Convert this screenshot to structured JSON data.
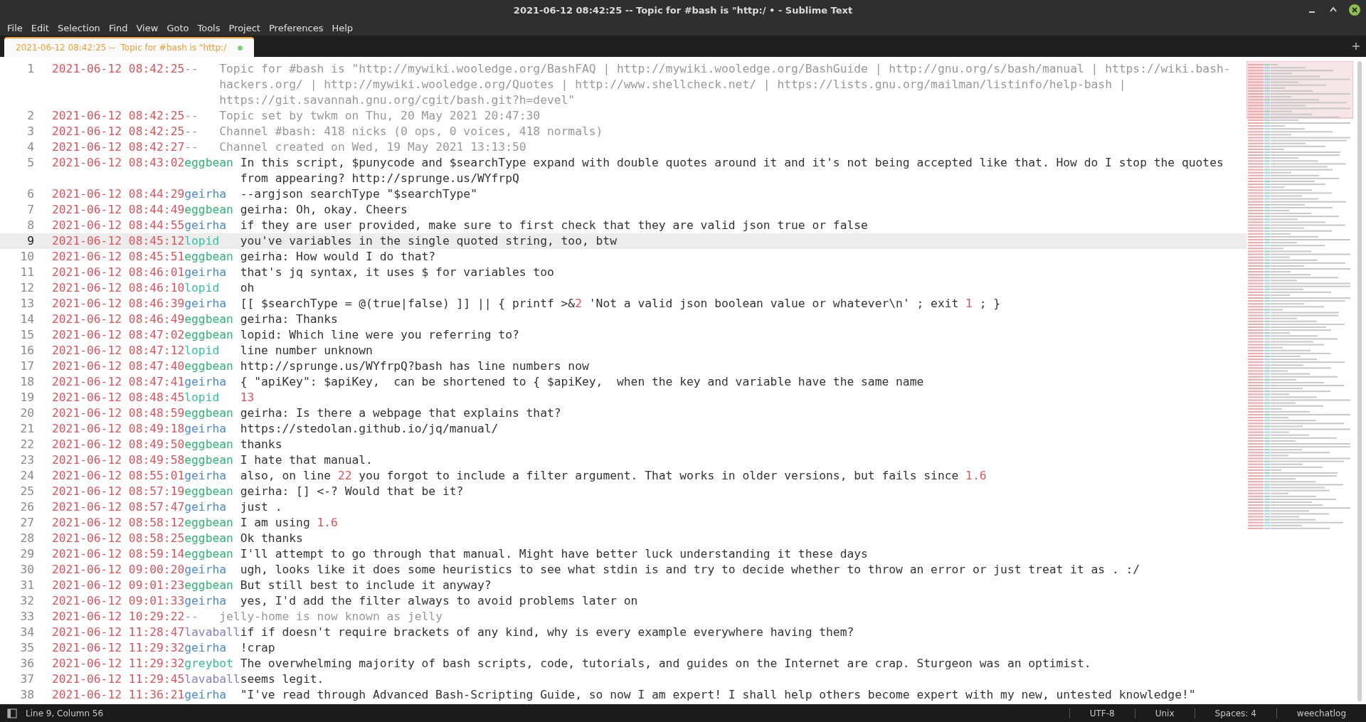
{
  "window": {
    "title": "2021-06-12 08:42:25 --  Topic for #bash is \"http:/ • - Sublime Text"
  },
  "menu": [
    "File",
    "Edit",
    "Selection",
    "Find",
    "View",
    "Goto",
    "Tools",
    "Project",
    "Preferences",
    "Help"
  ],
  "tabs": [
    {
      "label": "2021-06-12 08:42:25 --  Topic for #bash is \"http:/",
      "selected": true,
      "modified": true
    }
  ],
  "lines": [
    {
      "num": "1",
      "time": "2021-06-12 08:42:25",
      "kind": "system",
      "nick": "--",
      "color": "#a0a0a0",
      "current": false,
      "message": [
        {
          "kind": "text",
          "text": "Topic for #bash is \"http://mywiki.wooledge.org/BashFAQ | http://mywiki.wooledge.org/BashGuide | http://gnu.org/s/bash/manual | https://wiki.bash-hackers.org/ | http://mywiki.wooledge.org/Quotes | http://www.shellcheck.net/ | https://lists.gnu.org/mailman/listinfo/help-bash | https://git.savannah.gnu.org/cgit/bash.git?h=devel\""
        }
      ]
    },
    {
      "num": "2",
      "time": "2021-06-12 08:42:25",
      "kind": "system",
      "nick": "--",
      "color": "#a0a0a0",
      "current": false,
      "message": [
        {
          "kind": "text",
          "text": "Topic set by twkm on Thu, 20 May 2021 20:47:30"
        }
      ]
    },
    {
      "num": "3",
      "time": "2021-06-12 08:42:25",
      "kind": "system",
      "nick": "--",
      "color": "#a0a0a0",
      "current": false,
      "message": [
        {
          "kind": "text",
          "text": "Channel #bash: 418 nicks (0 ops, 0 voices, 418 normals)"
        }
      ]
    },
    {
      "num": "4",
      "time": "2021-06-12 08:42:27",
      "kind": "system",
      "nick": "--",
      "color": "#a0a0a0",
      "current": false,
      "message": [
        {
          "kind": "text",
          "text": "Channel created on Wed, 19 May 2021 13:13:50"
        }
      ]
    },
    {
      "num": "5",
      "time": "2021-06-12 08:43:02",
      "kind": "message",
      "nick": "eggbean",
      "color": "#2bb673",
      "current": false,
      "message": [
        {
          "kind": "text",
          "text": "In this script, $punycode and $searchType expand with double quotes around it and it's not being accepted like that. How do I stop the quotes from appearing? http://sprunge.us/WYfrpQ"
        }
      ]
    },
    {
      "num": "6",
      "time": "2021-06-12 08:44:29",
      "kind": "message",
      "nick": "geirha",
      "color": "#4a8bd0",
      "current": false,
      "message": [
        {
          "kind": "text",
          "text": "--argjson searchType \"$searchType\""
        }
      ]
    },
    {
      "num": "7",
      "time": "2021-06-12 08:44:49",
      "kind": "message",
      "nick": "eggbean",
      "color": "#2bb673",
      "current": false,
      "message": [
        {
          "kind": "text",
          "text": "geirha: Oh, okay. Cheers"
        }
      ]
    },
    {
      "num": "8",
      "time": "2021-06-12 08:44:55",
      "kind": "message",
      "nick": "geirha",
      "color": "#4a8bd0",
      "current": false,
      "message": [
        {
          "kind": "text",
          "text": "if they are user provided, make sure to first check that they are valid json true or false"
        }
      ]
    },
    {
      "num": "9",
      "time": "2021-06-12 08:45:12",
      "kind": "message",
      "nick": "lopid",
      "color": "#2ec4a3",
      "current": true,
      "message": [
        {
          "kind": "text",
          "text": "you've variables in the single quoted string, too, btw"
        }
      ]
    },
    {
      "num": "10",
      "time": "2021-06-12 08:45:51",
      "kind": "message",
      "nick": "eggbean",
      "color": "#2bb673",
      "current": false,
      "message": [
        {
          "kind": "text",
          "text": "geirha: How would I do that?"
        }
      ]
    },
    {
      "num": "11",
      "time": "2021-06-12 08:46:01",
      "kind": "message",
      "nick": "geirha",
      "color": "#4a8bd0",
      "current": false,
      "message": [
        {
          "kind": "text",
          "text": "that's jq syntax, it uses $ for variables too"
        }
      ]
    },
    {
      "num": "12",
      "time": "2021-06-12 08:46:10",
      "kind": "message",
      "nick": "lopid",
      "color": "#2ec4a3",
      "current": false,
      "message": [
        {
          "kind": "text",
          "text": "oh"
        }
      ]
    },
    {
      "num": "13",
      "time": "2021-06-12 08:46:39",
      "kind": "message",
      "nick": "geirha",
      "color": "#4a8bd0",
      "current": false,
      "message": [
        {
          "kind": "text",
          "text": "[[ $searchType = @(true|false) ]] || { printf >&"
        },
        {
          "kind": "number",
          "text": "2"
        },
        {
          "kind": "text",
          "text": " 'Not a valid json boolean value or whatever\\n' ; exit "
        },
        {
          "kind": "number",
          "text": "1"
        },
        {
          "kind": "text",
          "text": " ; }"
        }
      ]
    },
    {
      "num": "14",
      "time": "2021-06-12 08:46:49",
      "kind": "message",
      "nick": "eggbean",
      "color": "#2bb673",
      "current": false,
      "message": [
        {
          "kind": "text",
          "text": "geirha: Thanks"
        }
      ]
    },
    {
      "num": "15",
      "time": "2021-06-12 08:47:02",
      "kind": "message",
      "nick": "eggbean",
      "color": "#2bb673",
      "current": false,
      "message": [
        {
          "kind": "text",
          "text": "lopid: Which line were you referring to?"
        }
      ]
    },
    {
      "num": "16",
      "time": "2021-06-12 08:47:12",
      "kind": "message",
      "nick": "lopid",
      "color": "#2ec4a3",
      "current": false,
      "message": [
        {
          "kind": "text",
          "text": "line number unknown"
        }
      ]
    },
    {
      "num": "17",
      "time": "2021-06-12 08:47:40",
      "kind": "message",
      "nick": "eggbean",
      "color": "#2bb673",
      "current": false,
      "message": [
        {
          "kind": "text",
          "text": "http://sprunge.us/WYfrpQ?bash has line numbers now"
        }
      ]
    },
    {
      "num": "18",
      "time": "2021-06-12 08:47:41",
      "kind": "message",
      "nick": "geirha",
      "color": "#4a8bd0",
      "current": false,
      "message": [
        {
          "kind": "text",
          "text": "{ \"apiKey\": $apiKey,  can be shortened to { $apiKey,  when the key and variable have the same name"
        }
      ]
    },
    {
      "num": "19",
      "time": "2021-06-12 08:48:45",
      "kind": "message",
      "nick": "lopid",
      "color": "#2ec4a3",
      "current": false,
      "message": [
        {
          "kind": "number",
          "text": "13"
        }
      ]
    },
    {
      "num": "20",
      "time": "2021-06-12 08:48:59",
      "kind": "message",
      "nick": "eggbean",
      "color": "#2bb673",
      "current": false,
      "message": [
        {
          "kind": "text",
          "text": "geirha: Is there a webpage that explains that?"
        }
      ]
    },
    {
      "num": "21",
      "time": "2021-06-12 08:49:18",
      "kind": "message",
      "nick": "geirha",
      "color": "#4a8bd0",
      "current": false,
      "message": [
        {
          "kind": "text",
          "text": "https://stedolan.github.io/jq/manual/"
        }
      ]
    },
    {
      "num": "22",
      "time": "2021-06-12 08:49:50",
      "kind": "message",
      "nick": "eggbean",
      "color": "#2bb673",
      "current": false,
      "message": [
        {
          "kind": "text",
          "text": "thanks"
        }
      ]
    },
    {
      "num": "23",
      "time": "2021-06-12 08:49:58",
      "kind": "message",
      "nick": "eggbean",
      "color": "#2bb673",
      "current": false,
      "message": [
        {
          "kind": "text",
          "text": "I hate that manual."
        }
      ]
    },
    {
      "num": "24",
      "time": "2021-06-12 08:55:01",
      "kind": "message",
      "nick": "geirha",
      "color": "#4a8bd0",
      "current": false,
      "message": [
        {
          "kind": "text",
          "text": "also, on line "
        },
        {
          "kind": "number",
          "text": "22"
        },
        {
          "kind": "text",
          "text": " you forgot to include a filter argument. That works in older versions, but fails since "
        },
        {
          "kind": "number",
          "text": "1.6"
        }
      ]
    },
    {
      "num": "25",
      "time": "2021-06-12 08:57:19",
      "kind": "message",
      "nick": "eggbean",
      "color": "#2bb673",
      "current": false,
      "message": [
        {
          "kind": "text",
          "text": "geirha: [] <-? Would that be it?"
        }
      ]
    },
    {
      "num": "26",
      "time": "2021-06-12 08:57:47",
      "kind": "message",
      "nick": "geirha",
      "color": "#4a8bd0",
      "current": false,
      "message": [
        {
          "kind": "text",
          "text": "just ."
        }
      ]
    },
    {
      "num": "27",
      "time": "2021-06-12 08:58:12",
      "kind": "message",
      "nick": "eggbean",
      "color": "#2bb673",
      "current": false,
      "message": [
        {
          "kind": "text",
          "text": "I am using "
        },
        {
          "kind": "number",
          "text": "1.6"
        }
      ]
    },
    {
      "num": "28",
      "time": "2021-06-12 08:58:25",
      "kind": "message",
      "nick": "eggbean",
      "color": "#2bb673",
      "current": false,
      "message": [
        {
          "kind": "text",
          "text": "Ok thanks"
        }
      ]
    },
    {
      "num": "29",
      "time": "2021-06-12 08:59:14",
      "kind": "message",
      "nick": "eggbean",
      "color": "#2bb673",
      "current": false,
      "message": [
        {
          "kind": "text",
          "text": "I'll attempt to go through that manual. Might have better luck understanding it these days"
        }
      ]
    },
    {
      "num": "30",
      "time": "2021-06-12 09:00:20",
      "kind": "message",
      "nick": "geirha",
      "color": "#4a8bd0",
      "current": false,
      "message": [
        {
          "kind": "text",
          "text": "ugh, looks like it does some heuristics to see what stdin is and try to decide whether to throw an error or just treat it as . :/"
        }
      ]
    },
    {
      "num": "31",
      "time": "2021-06-12 09:01:23",
      "kind": "message",
      "nick": "eggbean",
      "color": "#2bb673",
      "current": false,
      "message": [
        {
          "kind": "text",
          "text": "But still best to include it anyway?"
        }
      ]
    },
    {
      "num": "32",
      "time": "2021-06-12 09:01:33",
      "kind": "message",
      "nick": "geirha",
      "color": "#4a8bd0",
      "current": false,
      "message": [
        {
          "kind": "text",
          "text": "yes, I'd add the filter always to avoid problems later on"
        }
      ]
    },
    {
      "num": "33",
      "time": "2021-06-12 10:29:22",
      "kind": "system",
      "nick": "--",
      "color": "#a0a0a0",
      "current": false,
      "message": [
        {
          "kind": "text",
          "text": "jelly-home is now known as jelly"
        }
      ]
    },
    {
      "num": "34",
      "time": "2021-06-12 11:28:47",
      "kind": "message",
      "nick": "lavaball",
      "color": "#8a7fc4",
      "current": false,
      "message": [
        {
          "kind": "text",
          "text": "if if doesn't require brackets of any kind, why is every example everywhere having them?"
        }
      ]
    },
    {
      "num": "35",
      "time": "2021-06-12 11:29:32",
      "kind": "message",
      "nick": "geirha",
      "color": "#4a8bd0",
      "current": false,
      "message": [
        {
          "kind": "text",
          "text": "!crap"
        }
      ]
    },
    {
      "num": "36",
      "time": "2021-06-12 11:29:32",
      "kind": "message",
      "nick": "greybot",
      "color": "#2fc28e",
      "current": false,
      "message": [
        {
          "kind": "text",
          "text": "The overwhelming majority of bash scripts, code, tutorials, and guides on the Internet are crap. Sturgeon was an optimist."
        }
      ]
    },
    {
      "num": "37",
      "time": "2021-06-12 11:29:45",
      "kind": "message",
      "nick": "lavaball",
      "color": "#8a7fc4",
      "current": false,
      "message": [
        {
          "kind": "text",
          "text": "seems legit."
        }
      ]
    },
    {
      "num": "38",
      "time": "2021-06-12 11:36:21",
      "kind": "message",
      "nick": "geirha",
      "color": "#4a8bd0",
      "current": false,
      "message": [
        {
          "kind": "text",
          "text": "\"I've read through Advanced Bash-Scripting Guide, so now I am expert! I shall help others become expert with my new, untested knowledge!\""
        }
      ]
    }
  ],
  "status_bar": {
    "position": "Line 9, Column 56",
    "encoding": "UTF-8",
    "line_endings": "Unix",
    "indentation": "Spaces: 4",
    "syntax": "weechatlog"
  }
}
